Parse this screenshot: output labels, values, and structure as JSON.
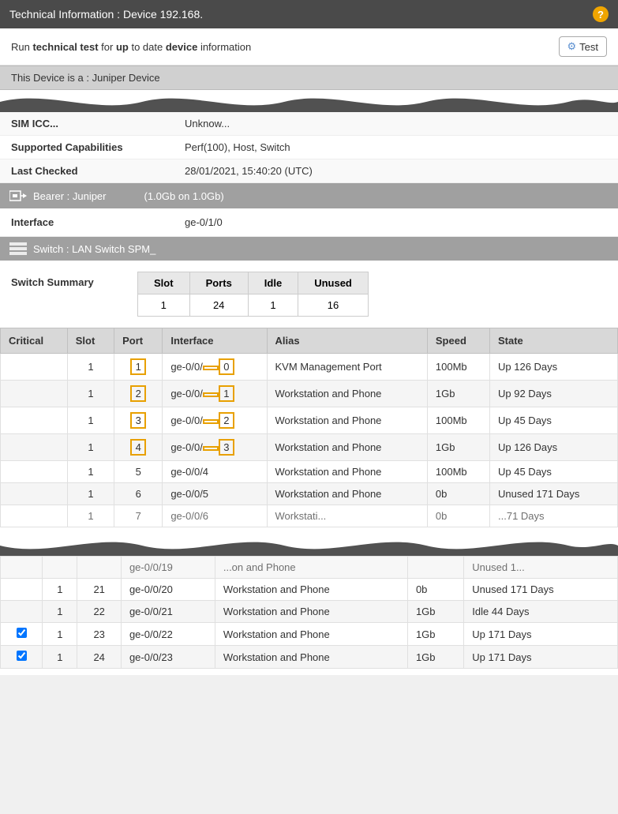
{
  "titleBar": {
    "title": "Technical Information : Device 192.168.",
    "helpIcon": "?"
  },
  "infoBar": {
    "text": "Run technical test for up to date device information",
    "runLabel": "Run",
    "technicalLabel": "technical test",
    "forLabel": "for",
    "upToDateLabel": "up to date device information",
    "testButton": "Test"
  },
  "deviceTypeBar": {
    "text": "This Device is a : Juniper Device"
  },
  "deviceInfo": [
    {
      "label": "SIM ICC...",
      "value": "Unknow..."
    },
    {
      "label": "Supported Capabilities",
      "value": "Perf(100), Host, Switch"
    },
    {
      "label": "Last Checked",
      "value": "28/01/2021, 15:40:20 (UTC)"
    }
  ],
  "bearerSection": {
    "icon": "⇦",
    "label": "Bearer : Juniper",
    "value": "(1.0Gb on 1.0Gb)"
  },
  "interface": {
    "label": "Interface",
    "value": "ge-0/1/0"
  },
  "switchSection": {
    "icon": "≡",
    "label": "Switch : LAN Switch SPM_"
  },
  "switchSummary": {
    "label": "Switch Summary",
    "columns": [
      "Slot",
      "Ports",
      "Idle",
      "Unused"
    ],
    "rows": [
      [
        "1",
        "24",
        "1",
        "16"
      ]
    ]
  },
  "portsTable": {
    "columns": [
      "Critical",
      "Slot",
      "Port",
      "Interface",
      "Alias",
      "Speed",
      "State"
    ],
    "rows": [
      {
        "critical": "",
        "slot": "1",
        "port": "1",
        "interface": "ge-0/0/0",
        "alias": "KVM Management Port",
        "speed": "100Mb",
        "state": "Up 126 Days",
        "portHighlight": true,
        "ifaceHighlight": true
      },
      {
        "critical": "",
        "slot": "1",
        "port": "2",
        "interface": "ge-0/0/1",
        "alias": "Workstation and Phone",
        "speed": "1Gb",
        "state": "Up 92 Days",
        "portHighlight": true,
        "ifaceHighlight": true
      },
      {
        "critical": "",
        "slot": "1",
        "port": "3",
        "interface": "ge-0/0/2",
        "alias": "Workstation and Phone",
        "speed": "100Mb",
        "state": "Up 45 Days",
        "portHighlight": true,
        "ifaceHighlight": true
      },
      {
        "critical": "",
        "slot": "1",
        "port": "4",
        "interface": "ge-0/0/3",
        "alias": "Workstation and Phone",
        "speed": "1Gb",
        "state": "Up 126 Days",
        "portHighlight": true,
        "ifaceHighlight": true
      },
      {
        "critical": "",
        "slot": "1",
        "port": "5",
        "interface": "ge-0/0/4",
        "alias": "Workstation and Phone",
        "speed": "100Mb",
        "state": "Up 45 Days",
        "portHighlight": false,
        "ifaceHighlight": false
      },
      {
        "critical": "",
        "slot": "1",
        "port": "6",
        "interface": "ge-0/0/5",
        "alias": "Workstation and Phone",
        "speed": "0b",
        "state": "Unused 171 Days",
        "portHighlight": false,
        "ifaceHighlight": false
      },
      {
        "critical": "",
        "slot": "1",
        "port": "7",
        "interface": "ge-0/0/6",
        "alias": "Workstati...",
        "speed": "0b",
        "state": "...71 Days",
        "portHighlight": false,
        "ifaceHighlight": false,
        "partial": true
      }
    ],
    "bottomRows": [
      {
        "critical": "",
        "slot": "",
        "port": "",
        "interface": "ge-0/0/19",
        "alias": "...on and Phone",
        "speed": "",
        "state": "Unused 1...",
        "portHighlight": false,
        "ifaceHighlight": false,
        "partial": true
      },
      {
        "critical": "",
        "slot": "1",
        "port": "21",
        "interface": "ge-0/0/20",
        "alias": "Workstation and Phone",
        "speed": "0b",
        "state": "Unused 171 Days",
        "portHighlight": false,
        "ifaceHighlight": false
      },
      {
        "critical": "",
        "slot": "1",
        "port": "22",
        "interface": "ge-0/0/21",
        "alias": "Workstation and Phone",
        "speed": "1Gb",
        "state": "Idle 44 Days",
        "portHighlight": false,
        "ifaceHighlight": false
      },
      {
        "critical": "✓",
        "slot": "1",
        "port": "23",
        "interface": "ge-0/0/22",
        "alias": "Workstation and Phone",
        "speed": "1Gb",
        "state": "Up 171 Days",
        "portHighlight": false,
        "ifaceHighlight": false,
        "hasCheckbox": true
      },
      {
        "critical": "✓",
        "slot": "1",
        "port": "24",
        "interface": "ge-0/0/23",
        "alias": "Workstation and Phone",
        "speed": "1Gb",
        "state": "Up 171 Days",
        "portHighlight": false,
        "ifaceHighlight": false,
        "hasCheckbox": true
      }
    ]
  }
}
